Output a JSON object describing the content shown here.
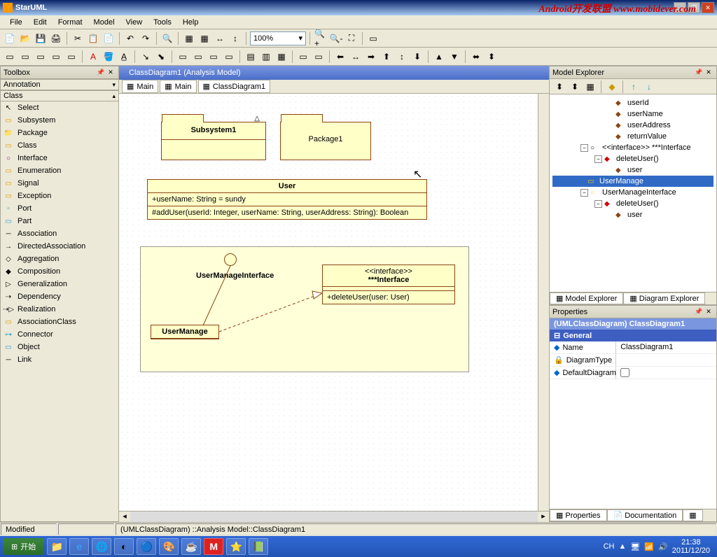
{
  "window": {
    "title": "StarUML"
  },
  "watermark": "Android开发联盟  www.mobidever.com",
  "menu": [
    "File",
    "Edit",
    "Format",
    "Model",
    "View",
    "Tools",
    "Help"
  ],
  "zoom": "100%",
  "toolbox": {
    "title": "Toolbox",
    "sections": {
      "annotation": "Annotation",
      "class": "Class"
    },
    "tools": [
      "Select",
      "Subsystem",
      "Package",
      "Class",
      "Interface",
      "Enumeration",
      "Signal",
      "Exception",
      "Port",
      "Part",
      "Association",
      "DirectedAssociation",
      "Aggregation",
      "Composition",
      "Generalization",
      "Dependency",
      "Realization",
      "AssociationClass",
      "Connector",
      "Object",
      "Link"
    ]
  },
  "diagram": {
    "tab_title": "ClassDiagram1 (Analysis Model)",
    "subtabs": [
      "Main",
      "Main",
      "ClassDiagram1"
    ],
    "subsystem": "Subsystem1",
    "package": "Package1",
    "user_class": {
      "name": "User",
      "attr": "+userName: String = sundy",
      "op": "#addUser(userId: Integer, userName: String, userAddress: String): Boolean"
    },
    "umi": "UserManageInterface",
    "um": "UserManage",
    "iface": {
      "stereo": "<<interface>>",
      "name": "***Interface",
      "op": "+deleteUser(user: User)"
    }
  },
  "explorer": {
    "title": "Model Explorer",
    "nodes": {
      "userId": "userId",
      "userName": "userName",
      "userAddress": "userAddress",
      "returnValue": "returnValue",
      "iface": "<<interface>> ***Interface",
      "deleteUser": "deleteUser()",
      "user": "user",
      "userManage": "UserManage",
      "umi": "UserManageInterface"
    },
    "btabs": {
      "model": "Model Explorer",
      "diagram": "Diagram Explorer"
    }
  },
  "props": {
    "title": "Properties",
    "head": "(UMLClassDiagram) ClassDiagram1",
    "cat": "General",
    "rows": {
      "name": {
        "k": "Name",
        "v": "ClassDiagram1"
      },
      "dtype": {
        "k": "DiagramType",
        "v": ""
      },
      "def": {
        "k": "DefaultDiagram",
        "v": ""
      }
    },
    "btabs": {
      "props": "Properties",
      "docs": "Documentation"
    }
  },
  "status": {
    "modified": "Modified",
    "path": "(UMLClassDiagram) ::Analysis Model::ClassDiagram1"
  },
  "taskbar": {
    "start": "开始",
    "lang": "CH",
    "time": "21:38",
    "date": "2011/12/20"
  }
}
